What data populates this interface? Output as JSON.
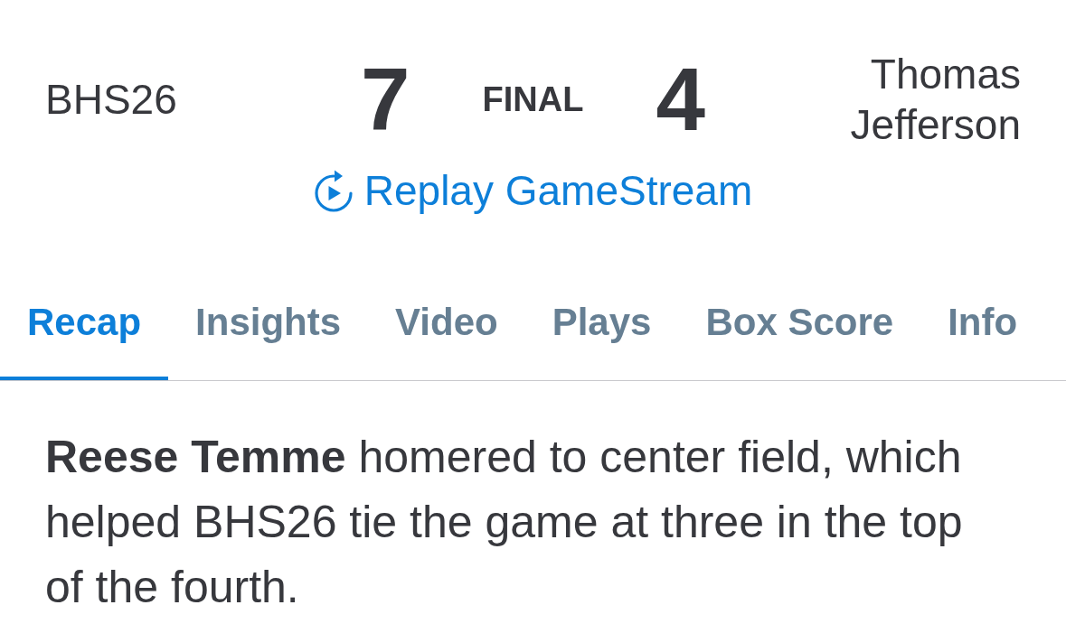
{
  "scoreboard": {
    "home_team": "BHS26",
    "home_score": "7",
    "status": "FINAL",
    "away_score": "4",
    "away_team": "Thomas Jefferson",
    "replay_link": "Replay GameStream"
  },
  "tabs": [
    {
      "label": "Recap",
      "selected": true
    },
    {
      "label": "Insights",
      "selected": false
    },
    {
      "label": "Video",
      "selected": false
    },
    {
      "label": "Plays",
      "selected": false
    },
    {
      "label": "Box Score",
      "selected": false
    },
    {
      "label": "Info",
      "selected": false
    }
  ],
  "recap": {
    "text": "**Reese Temme** homered to center field, which helped BHS26 tie the game at three in the top of the fourth."
  }
}
